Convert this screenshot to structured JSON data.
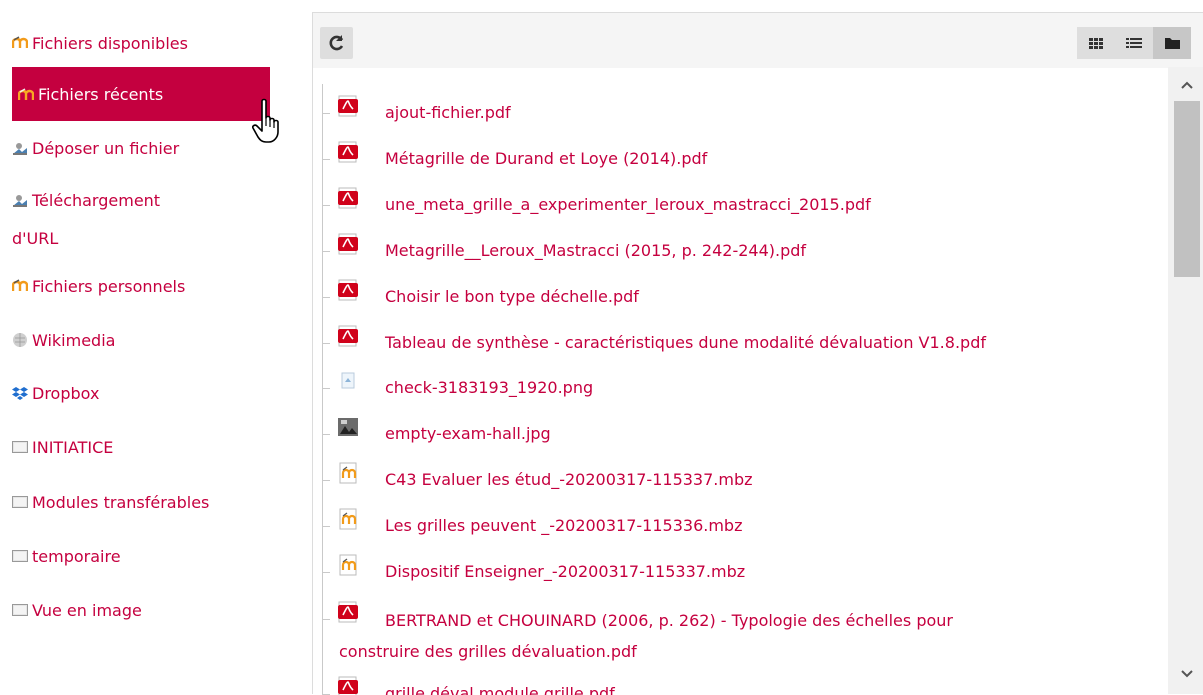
{
  "sidebar": {
    "items": [
      {
        "label": "Fichiers disponibles",
        "icon": "moodle-icon"
      },
      {
        "label": "Fichiers récents",
        "icon": "moodle-icon"
      },
      {
        "label": "Déposer un fichier",
        "icon": "upload-icon"
      },
      {
        "label": "Téléchargement",
        "label2": "d'URL",
        "icon": "url-download-icon"
      },
      {
        "label": "Fichiers personnels",
        "icon": "moodle-icon"
      },
      {
        "label": "Wikimedia",
        "icon": "wikimedia-icon"
      },
      {
        "label": "Dropbox",
        "icon": "dropbox-icon"
      },
      {
        "label": "INITIATICE",
        "icon": "repository-icon"
      },
      {
        "label": "Modules transférables",
        "icon": "repository-icon"
      },
      {
        "label": "temporaire",
        "icon": "repository-icon"
      },
      {
        "label": "Vue en image",
        "icon": "repository-icon"
      }
    ]
  },
  "toolbar": {
    "refresh_icon": "refresh-icon",
    "views": [
      "grid-view-icon",
      "list-view-icon",
      "folder-view-icon"
    ]
  },
  "files": [
    {
      "name": "ajout-fichier.pdf",
      "type": "pdf"
    },
    {
      "name": "Métagrille de Durand et Loye (2014).pdf",
      "type": "pdf"
    },
    {
      "name": "une_meta_grille_a_experimenter_leroux_mastracci_2015.pdf",
      "type": "pdf"
    },
    {
      "name": "Metagrille__Leroux_Mastracci (2015, p. 242-244).pdf",
      "type": "pdf"
    },
    {
      "name": "Choisir le bon type déchelle.pdf",
      "type": "pdf"
    },
    {
      "name": "Tableau de synthèse - caractéristiques dune modalité dévaluation V1.8.pdf",
      "type": "pdf"
    },
    {
      "name": "check-3183193_1920.png",
      "type": "png"
    },
    {
      "name": "empty-exam-hall.jpg",
      "type": "jpg"
    },
    {
      "name": "C43 Evaluer les étud_-20200317-115337.mbz",
      "type": "mbz"
    },
    {
      "name": "Les grilles peuvent _-20200317-115336.mbz",
      "type": "mbz"
    },
    {
      "name": "Dispositif Enseigner_-20200317-115337.mbz",
      "type": "mbz"
    },
    {
      "name": "BERTRAND et CHOUINARD (2006, p. 262) - Typologie des échelles pour",
      "name_line2": "construire des grilles dévaluation.pdf",
      "type": "pdf"
    },
    {
      "name": "grille déval module grille.pdf",
      "type": "pdf"
    }
  ],
  "colors": {
    "accent": "#c4003f",
    "link": "#c5003f"
  }
}
